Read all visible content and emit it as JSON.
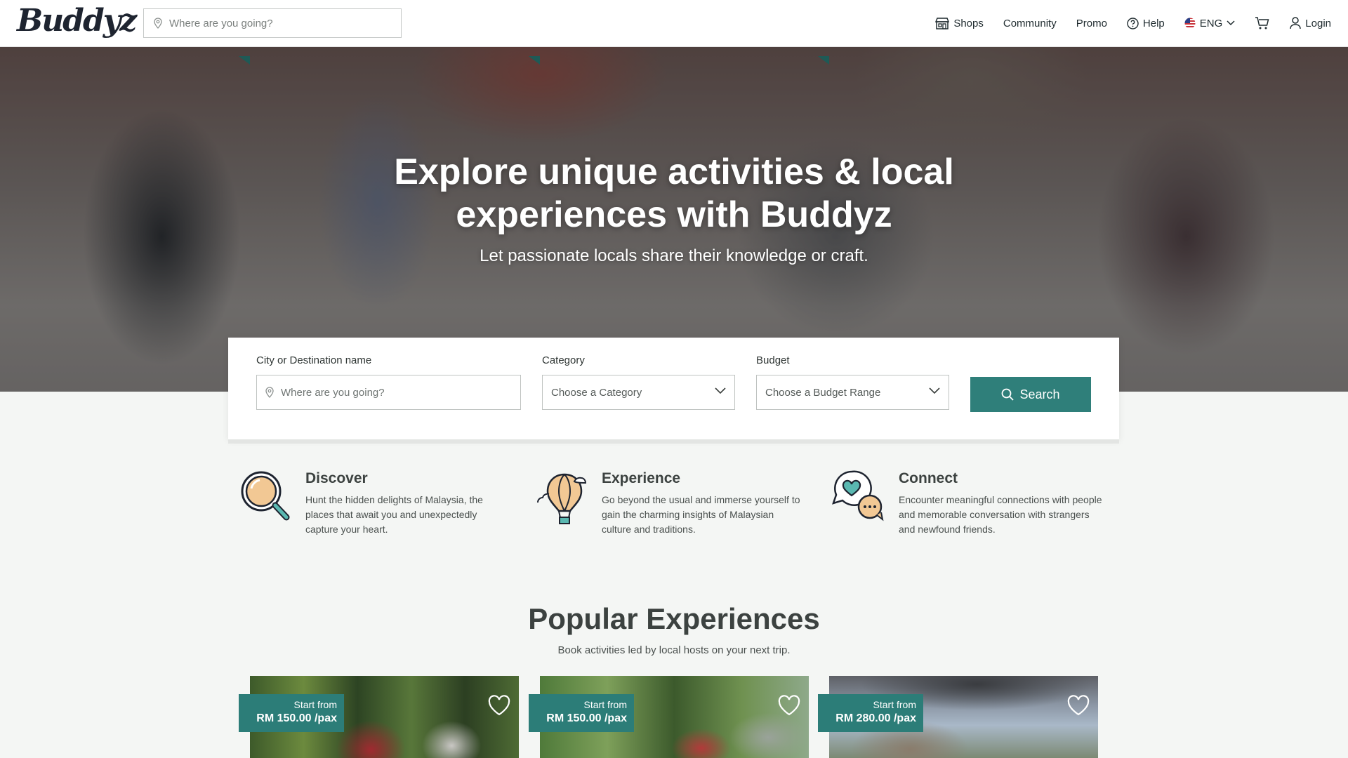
{
  "brand": {
    "logo_text": "Buddyz"
  },
  "header": {
    "search_placeholder": "Where are you going?",
    "nav": {
      "shops": "Shops",
      "community": "Community",
      "promo": "Promo",
      "help": "Help",
      "language": "ENG",
      "login": "Login"
    }
  },
  "hero": {
    "title_line1": "Explore unique activities & local",
    "title_line2": "experiences with Buddyz",
    "subtitle": "Let passionate locals share their knowledge or craft."
  },
  "search": {
    "destination_label": "City or Destination name",
    "destination_placeholder": "Where are you going?",
    "category_label": "Category",
    "category_value": "Choose a Category",
    "budget_label": "Budget",
    "budget_value": "Choose a Budget Range",
    "button_label": "Search"
  },
  "features": [
    {
      "icon": "magnifier-icon",
      "title": "Discover",
      "desc": "Hunt the hidden delights of Malaysia, the places that await you and unexpectedly capture your heart."
    },
    {
      "icon": "hot-air-balloon-icon",
      "title": "Experience",
      "desc": "Go beyond the usual and immerse yourself to gain the charming insights of Malaysian culture and traditions."
    },
    {
      "icon": "chat-bubbles-icon",
      "title": "Connect",
      "desc": "Encounter meaningful connections with people and memorable conversation with strangers and newfound friends."
    }
  ],
  "popular": {
    "title": "Popular Experiences",
    "subtitle": "Book activities led by local hosts on your next trip.",
    "cards": [
      {
        "start_label": "Start from",
        "price": "RM 150.00 /pax"
      },
      {
        "start_label": "Start from",
        "price": "RM 150.00 /pax"
      },
      {
        "start_label": "Start from",
        "price": "RM 280.00 /pax"
      }
    ]
  },
  "colors": {
    "accent": "#2f7f7a",
    "price_tag": "#2c7d78",
    "page_bg": "#f4f6f4"
  }
}
